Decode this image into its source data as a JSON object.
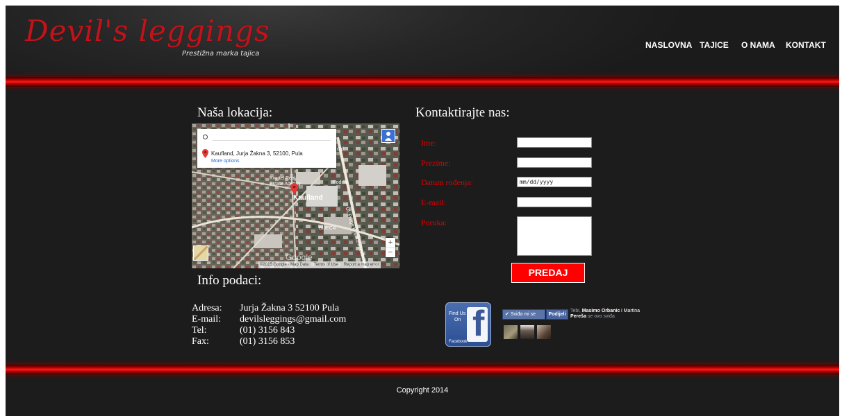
{
  "brand": {
    "logo": "Devil's leggings",
    "tagline": "Prestižna marka tajica"
  },
  "nav": {
    "items": [
      "NASLOVNA",
      "TAJICE",
      "O NAMA",
      "KONTAKT"
    ]
  },
  "location": {
    "title": "Naša lokacija:",
    "map": {
      "address": "Kaufland, Jurja Žakna 3, 52100, Pula",
      "more_options": "More options",
      "labels": [
        "Kvintel Real Estate Agency",
        "Kaufland",
        "Podine",
        "BRIONI d.d.",
        "BIJECA",
        "Ul. Pruge Kovačevićevih Bakrina"
      ],
      "footer": [
        "©2015 Google · Map Data",
        "Terms of Use",
        "Report a map error"
      ],
      "google": "Google"
    }
  },
  "contact": {
    "title": "Kontaktirajte nas:",
    "fields": [
      {
        "label": "Ime:",
        "value": ""
      },
      {
        "label": "Prezime:",
        "value": ""
      },
      {
        "label": "Datum rođenja:",
        "value": "mm/dd/yyyy"
      },
      {
        "label": "E-mail:",
        "value": ""
      },
      {
        "label": "Poruka:",
        "value": ""
      }
    ],
    "submit": "PREDAJ"
  },
  "info": {
    "title": "Info podaci:",
    "rows": [
      {
        "label": "Adresa:",
        "value": "Jurja Žakna 3 52100 Pula"
      },
      {
        "label": "E-mail:",
        "value": "devilsleggings@gmail.com"
      },
      {
        "label": "Tel:",
        "value": "(01) 3156 843"
      },
      {
        "label": "Fax:",
        "value": "(01) 3156 853"
      }
    ]
  },
  "social": {
    "find_us_line1": "Find Us",
    "find_us_line2": "On",
    "facebook": "Facebook",
    "like": "Sviđa mi se",
    "share": "Podijeli",
    "friends_prefix": "Tebi,",
    "friends": "Masimo Orbanic",
    "friends_sep": "i Martina",
    "friends_name2": "Pereša",
    "friends_suffix": "se ovo sviđa"
  },
  "footer": {
    "copyright": "Copyright 2014"
  },
  "colors": {
    "accent": "#ff0000",
    "label_red": "#e00000",
    "facebook_blue": "#3b5998",
    "background": "#1c1c1c"
  }
}
